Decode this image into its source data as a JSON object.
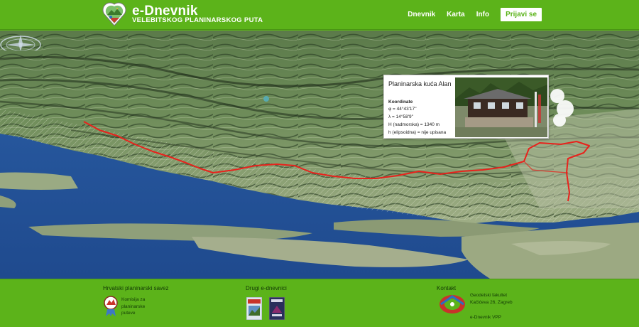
{
  "header": {
    "title": "e-Dnevnik",
    "subtitle": "VELEBITSKOG PLANINARSKOG PUTA",
    "nav": [
      "Dnevnik",
      "Karta",
      "Info"
    ],
    "login_label": "Prijavi se",
    "logo_icon": "mountain-badge-icon"
  },
  "map": {
    "info_card": {
      "title": "Planinarska kuća Alan",
      "coords_heading": "Koordinate",
      "phi": "φ = 44°43'17''",
      "lambda": "λ = 14°58'9''",
      "height": "H (nadmorska) = 1340 m",
      "ellipsoid": "h (elipsoidna) = nije upisana"
    },
    "trail_color": "#e8221c"
  },
  "footer": {
    "hps": {
      "heading": "Hrvatski planinarski savez",
      "text": "Komisija za planinarske puteve"
    },
    "others": {
      "heading": "Drugi e-dnevnici"
    },
    "contact": {
      "heading": "Kontakt",
      "address_line1": "Geodetski fakultet",
      "address_line2": "Kačićeva 26, Zagreb",
      "site": "e-Dnevnik VPP"
    }
  },
  "colors": {
    "brand_green": "#5cb31a",
    "sea_blue": "#2f63a8"
  }
}
